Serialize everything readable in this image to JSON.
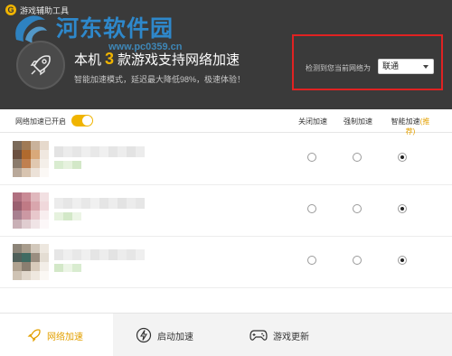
{
  "app": {
    "title": "游戏辅助工具",
    "logo_letter": "G"
  },
  "watermark": {
    "main": "河东软件园",
    "sub": "www.pc0359.cn"
  },
  "hero": {
    "headline_pre": "本机",
    "count": "3",
    "headline_post": "款游戏支持网络加速",
    "subline": "智能加速模式，延迟最大降低98%，极速体验！"
  },
  "network": {
    "detect_label": "检测到您当前网络为",
    "isp_value": "联通"
  },
  "toolbar": {
    "accel_label": "网络加速已开启",
    "accel_on": true,
    "col_off": "关闭加速",
    "col_force": "强制加速",
    "col_smart": "智能加速",
    "col_smart_rec": "(推荐)"
  },
  "games": [
    {
      "mode": "smart",
      "colors": [
        "#7b6a5a",
        "#a07a55",
        "#c9b29b",
        "#e6d9cc",
        "#6b5040",
        "#b06a2e",
        "#d9a97a",
        "#f0e8e0",
        "#8a7a6b",
        "#c08050",
        "#e0c8b0",
        "#f4efe9",
        "#b9a99a",
        "#d8c4b0",
        "#ece2d8",
        "#fbf8f5"
      ]
    },
    {
      "mode": "smart",
      "colors": [
        "#b07080",
        "#c98a95",
        "#e0b8bd",
        "#f2e0e2",
        "#9a6070",
        "#c07a85",
        "#d9a6ad",
        "#f0d8db",
        "#a88090",
        "#cc98a3",
        "#e8c8cc",
        "#f8eeef",
        "#c9b0b6",
        "#e0cdd0",
        "#f0e4e6",
        "#fcf7f8"
      ]
    },
    {
      "mode": "smart",
      "colors": [
        "#8c8478",
        "#a89c8c",
        "#d2c8bb",
        "#ede7df",
        "#50605a",
        "#3f6b62",
        "#9a8e80",
        "#e4ddd3",
        "#b0a290",
        "#8a7e70",
        "#d8cbbb",
        "#f3eee8",
        "#cfc3b4",
        "#e2d8cc",
        "#efe8df",
        "#fbf8f4"
      ]
    }
  ],
  "nav": {
    "accel": "网络加速",
    "boot": "启动加速",
    "update": "游戏更新"
  },
  "colors": {
    "accent": "#f0b400",
    "header_bg": "#3a3a3a",
    "highlight_box": "#e02222"
  }
}
